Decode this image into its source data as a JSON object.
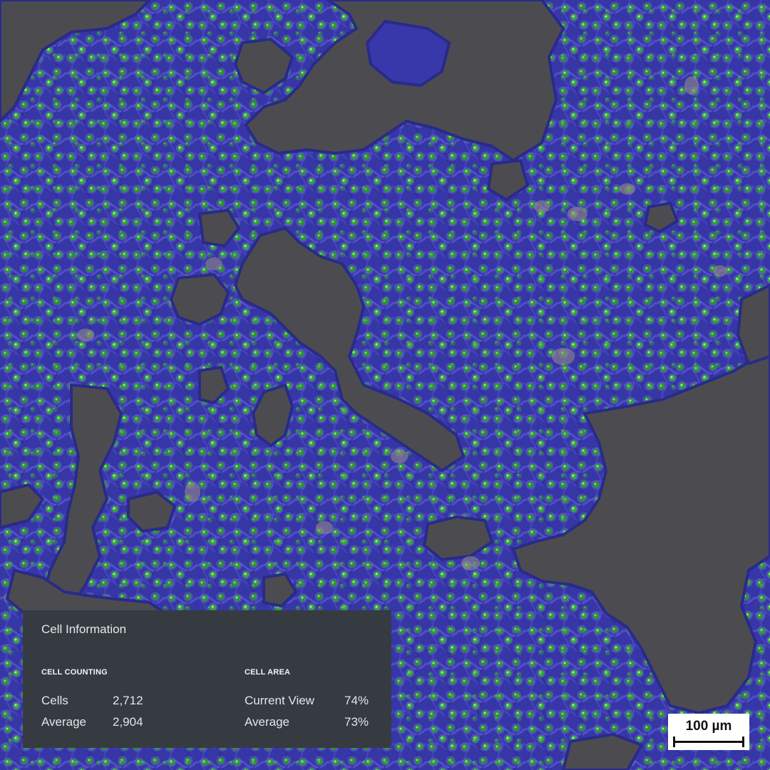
{
  "image": {
    "description_icon": "microscopy-phase-contrast",
    "colors": {
      "cell_mask": "#3b3bb0",
      "nucleus_marker": "#2d9a2d",
      "nucleus_highlight": "#8ef08e",
      "background_region": "#4d4d50",
      "panel_background": "#363b42"
    }
  },
  "cell_information": {
    "title": "Cell Information",
    "cell_counting": {
      "heading": "CELL COUNTING",
      "rows": [
        {
          "label": "Cells",
          "value": "2,712"
        },
        {
          "label": "Average",
          "value": "2,904"
        }
      ]
    },
    "cell_area": {
      "heading": "CELL AREA",
      "rows": [
        {
          "label": "Current View",
          "value": "74%"
        },
        {
          "label": "Average",
          "value": "73%"
        }
      ]
    }
  },
  "scale_bar": {
    "label": "100 µm"
  }
}
